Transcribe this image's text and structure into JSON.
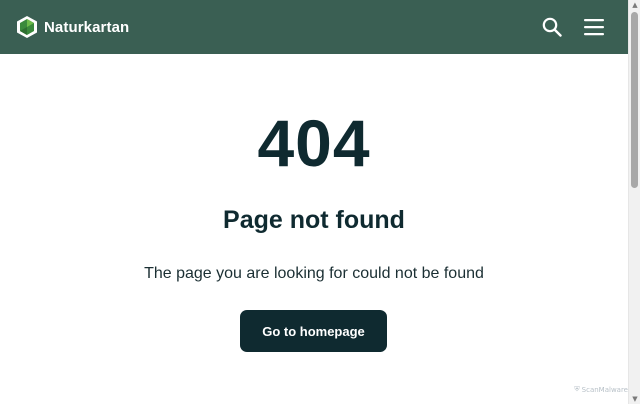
{
  "header": {
    "brand_name": "Naturkartan",
    "logo_icon": "naturkartan-logo-icon",
    "search_icon": "search-icon",
    "menu_icon": "hamburger-menu-icon",
    "background_color": "#3a5f53"
  },
  "error": {
    "code": "404",
    "title": "Page not found",
    "message": "The page you are looking for could not be found",
    "button_label": "Go to homepage",
    "button_color": "#0f2a30"
  },
  "watermark": {
    "text": "ScanMalware"
  }
}
